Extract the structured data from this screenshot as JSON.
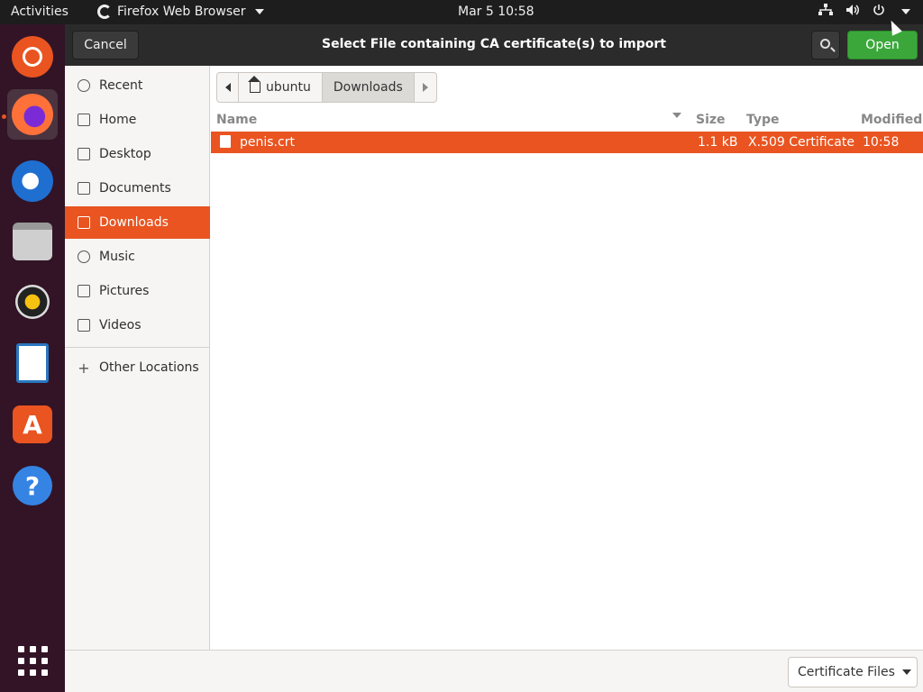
{
  "topbar": {
    "activities": "Activities",
    "app_name": "Firefox Web Browser",
    "clock": "Mar 5  10:58"
  },
  "dock": {
    "apps": [
      "ubuntu",
      "firefox",
      "thunderbird",
      "files",
      "rhythmbox",
      "writer",
      "software",
      "help"
    ]
  },
  "dialog": {
    "title": "Select File containing CA certificate(s) to import",
    "cancel_label": "Cancel",
    "open_label": "Open"
  },
  "sidebar": {
    "items": [
      {
        "label": "Recent",
        "icon": "clock-icon"
      },
      {
        "label": "Home",
        "icon": "home-icon"
      },
      {
        "label": "Desktop",
        "icon": "desktop-icon"
      },
      {
        "label": "Documents",
        "icon": "document-icon"
      },
      {
        "label": "Downloads",
        "icon": "download-icon"
      },
      {
        "label": "Music",
        "icon": "music-icon"
      },
      {
        "label": "Pictures",
        "icon": "picture-icon"
      },
      {
        "label": "Videos",
        "icon": "video-icon"
      }
    ],
    "other_locations": "Other Locations"
  },
  "pathbar": {
    "home": "ubuntu",
    "current": "Downloads"
  },
  "list": {
    "columns": {
      "name": "Name",
      "size": "Size",
      "type": "Type",
      "modified": "Modified"
    },
    "rows": [
      {
        "name": "penis.crt",
        "size": "1.1 kB",
        "type": "X.509 Certificate",
        "modified": "10:58"
      }
    ]
  },
  "footer": {
    "filter": "Certificate Files"
  },
  "colors": {
    "accent": "#e95420",
    "open_button": "#3ba73b"
  }
}
